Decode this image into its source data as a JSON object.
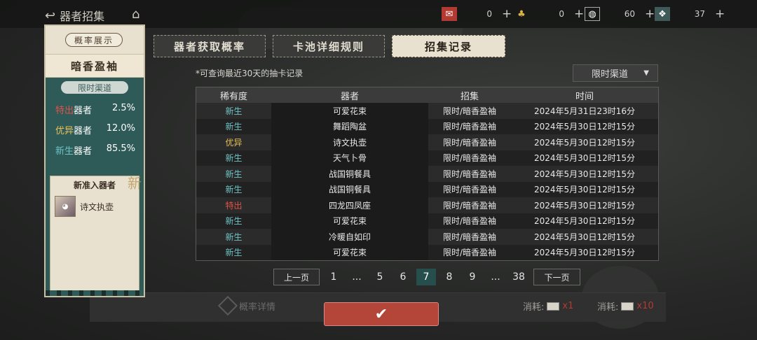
{
  "topbar": {
    "title": "器者招集",
    "currencies": [
      {
        "icon": "envelope-red-icon",
        "value": "0"
      },
      {
        "icon": "gold-envelope-icon",
        "value": "0"
      },
      {
        "icon": "token-icon",
        "value": "60"
      },
      {
        "icon": "scroll-icon",
        "value": "37"
      }
    ]
  },
  "left_panel": {
    "header": "概率展示",
    "title": "暗香盈袖",
    "channel": "限时渠道",
    "rates": [
      {
        "tier": "特出",
        "label": "器者",
        "value": "2.5%",
        "color": "#e0524a"
      },
      {
        "tier": "优异",
        "label": "器者",
        "value": "12.0%",
        "color": "#e8c25a"
      },
      {
        "tier": "新生",
        "label": "器者",
        "value": "85.5%",
        "color": "#6fc3c6"
      }
    ],
    "new_section": {
      "title": "新准入器者",
      "badge": "新",
      "item_name": "诗文执壶"
    }
  },
  "tabs": [
    {
      "label": "器者获取概率",
      "active": false
    },
    {
      "label": "卡池详细规则",
      "active": false
    },
    {
      "label": "招集记录",
      "active": true
    }
  ],
  "note": "*可查询最近30天的抽卡记录",
  "filter": {
    "label": "限时渠道"
  },
  "table": {
    "headers": [
      "稀有度",
      "器者",
      "招集",
      "时间"
    ],
    "rows": [
      {
        "rarity": "新生",
        "rarity_color": "#6fc3c6",
        "name": "可爱花束",
        "pool": "限时/暗香盈袖",
        "time": "2024年5月31日23时16分"
      },
      {
        "rarity": "新生",
        "rarity_color": "#6fc3c6",
        "name": "舞蹈陶盆",
        "pool": "限时/暗香盈袖",
        "time": "2024年5月30日12时15分"
      },
      {
        "rarity": "优异",
        "rarity_color": "#e8c25a",
        "name": "诗文执壶",
        "pool": "限时/暗香盈袖",
        "time": "2024年5月30日12时15分"
      },
      {
        "rarity": "新生",
        "rarity_color": "#6fc3c6",
        "name": "天气卜骨",
        "pool": "限时/暗香盈袖",
        "time": "2024年5月30日12时15分"
      },
      {
        "rarity": "新生",
        "rarity_color": "#6fc3c6",
        "name": "战国铜餐具",
        "pool": "限时/暗香盈袖",
        "time": "2024年5月30日12时15分"
      },
      {
        "rarity": "新生",
        "rarity_color": "#6fc3c6",
        "name": "战国铜餐具",
        "pool": "限时/暗香盈袖",
        "time": "2024年5月30日12时15分"
      },
      {
        "rarity": "特出",
        "rarity_color": "#e0524a",
        "name": "四龙四凤座",
        "pool": "限时/暗香盈袖",
        "time": "2024年5月30日12时15分"
      },
      {
        "rarity": "新生",
        "rarity_color": "#6fc3c6",
        "name": "可爱花束",
        "pool": "限时/暗香盈袖",
        "time": "2024年5月30日12时15分"
      },
      {
        "rarity": "新生",
        "rarity_color": "#6fc3c6",
        "name": "冷暖自如印",
        "pool": "限时/暗香盈袖",
        "time": "2024年5月30日12时15分"
      },
      {
        "rarity": "新生",
        "rarity_color": "#6fc3c6",
        "name": "可爱花束",
        "pool": "限时/暗香盈袖",
        "time": "2024年5月30日12时15分"
      }
    ]
  },
  "pager": {
    "prev": "上一页",
    "next": "下一页",
    "pages": [
      "1",
      "...",
      "5",
      "6",
      "7",
      "8",
      "9",
      "...",
      "38"
    ],
    "current": "7"
  },
  "background": {
    "prob_detail": "概率详情",
    "costs": [
      {
        "label": "消耗:",
        "value": "x1"
      },
      {
        "label": "消耗:",
        "value": "x10"
      }
    ]
  }
}
